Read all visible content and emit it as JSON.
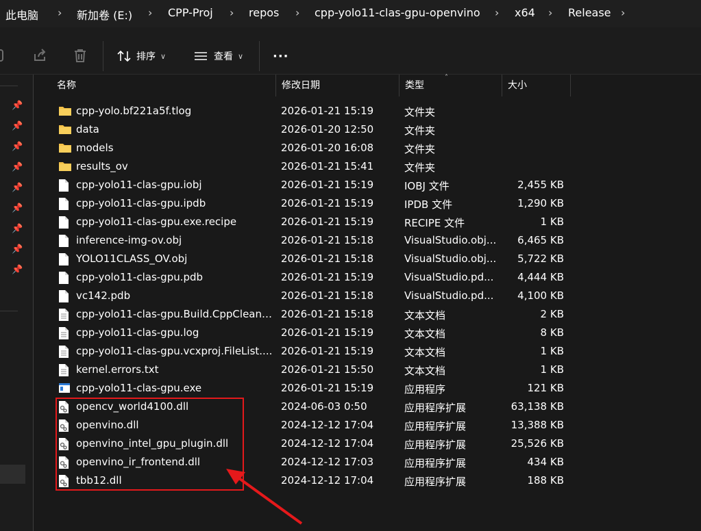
{
  "breadcrumb": [
    "此电脑",
    "新加卷 (E:)",
    "CPP-Proj",
    "repos",
    "cpp-yolo11-clas-gpu-openvino",
    "x64",
    "Release"
  ],
  "toolbar": {
    "sort_label": "排序",
    "view_label": "查看",
    "more_label": "···"
  },
  "columns": {
    "name": "名称",
    "date": "修改日期",
    "type": "类型",
    "size": "大小"
  },
  "files": [
    {
      "name": "cpp-yolo.bf221a5f.tlog",
      "date": "2026-01-21 15:19",
      "type": "文件夹",
      "size": "",
      "icon": "folder-icon"
    },
    {
      "name": "data",
      "date": "2026-01-20 12:50",
      "type": "文件夹",
      "size": "",
      "icon": "folder-icon"
    },
    {
      "name": "models",
      "date": "2026-01-20 16:08",
      "type": "文件夹",
      "size": "",
      "icon": "folder-icon"
    },
    {
      "name": "results_ov",
      "date": "2026-01-21 15:41",
      "type": "文件夹",
      "size": "",
      "icon": "folder-icon"
    },
    {
      "name": "cpp-yolo11-clas-gpu.iobj",
      "date": "2026-01-21 15:19",
      "type": "IOBJ 文件",
      "size": "2,455 KB",
      "icon": "file-icon"
    },
    {
      "name": "cpp-yolo11-clas-gpu.ipdb",
      "date": "2026-01-21 15:19",
      "type": "IPDB 文件",
      "size": "1,290 KB",
      "icon": "file-icon"
    },
    {
      "name": "cpp-yolo11-clas-gpu.exe.recipe",
      "date": "2026-01-21 15:19",
      "type": "RECIPE 文件",
      "size": "1 KB",
      "icon": "file-icon"
    },
    {
      "name": "inference-img-ov.obj",
      "date": "2026-01-21 15:18",
      "type": "VisualStudio.obj...",
      "size": "6,465 KB",
      "icon": "file-icon"
    },
    {
      "name": "YOLO11CLASS_OV.obj",
      "date": "2026-01-21 15:18",
      "type": "VisualStudio.obj...",
      "size": "5,722 KB",
      "icon": "file-icon"
    },
    {
      "name": "cpp-yolo11-clas-gpu.pdb",
      "date": "2026-01-21 15:19",
      "type": "VisualStudio.pd...",
      "size": "4,444 KB",
      "icon": "file-icon"
    },
    {
      "name": "vc142.pdb",
      "date": "2026-01-21 15:18",
      "type": "VisualStudio.pd...",
      "size": "4,100 KB",
      "icon": "file-icon"
    },
    {
      "name": "cpp-yolo11-clas-gpu.Build.CppClean....",
      "date": "2026-01-21 15:18",
      "type": "文本文档",
      "size": "2 KB",
      "icon": "text-file-icon"
    },
    {
      "name": "cpp-yolo11-clas-gpu.log",
      "date": "2026-01-21 15:19",
      "type": "文本文档",
      "size": "8 KB",
      "icon": "text-file-icon"
    },
    {
      "name": "cpp-yolo11-clas-gpu.vcxproj.FileList....",
      "date": "2026-01-21 15:19",
      "type": "文本文档",
      "size": "1 KB",
      "icon": "text-file-icon"
    },
    {
      "name": "kernel.errors.txt",
      "date": "2026-01-21 15:50",
      "type": "文本文档",
      "size": "1 KB",
      "icon": "text-file-icon"
    },
    {
      "name": "cpp-yolo11-clas-gpu.exe",
      "date": "2026-01-21 15:19",
      "type": "应用程序",
      "size": "121 KB",
      "icon": "exe-icon"
    },
    {
      "name": "opencv_world4100.dll",
      "date": "2024-06-03 0:50",
      "type": "应用程序扩展",
      "size": "63,138 KB",
      "icon": "dll-icon"
    },
    {
      "name": "openvino.dll",
      "date": "2024-12-12 17:04",
      "type": "应用程序扩展",
      "size": "13,388 KB",
      "icon": "dll-icon"
    },
    {
      "name": "openvino_intel_gpu_plugin.dll",
      "date": "2024-12-12 17:04",
      "type": "应用程序扩展",
      "size": "25,526 KB",
      "icon": "dll-icon"
    },
    {
      "name": "openvino_ir_frontend.dll",
      "date": "2024-12-12 17:03",
      "type": "应用程序扩展",
      "size": "434 KB",
      "icon": "dll-icon"
    },
    {
      "name": "tbb12.dll",
      "date": "2024-12-12 17:04",
      "type": "应用程序扩展",
      "size": "188 KB",
      "icon": "dll-icon"
    }
  ],
  "colors": {
    "folder": "#f4c148",
    "annotation": "#e5191b",
    "background": "#191919"
  }
}
